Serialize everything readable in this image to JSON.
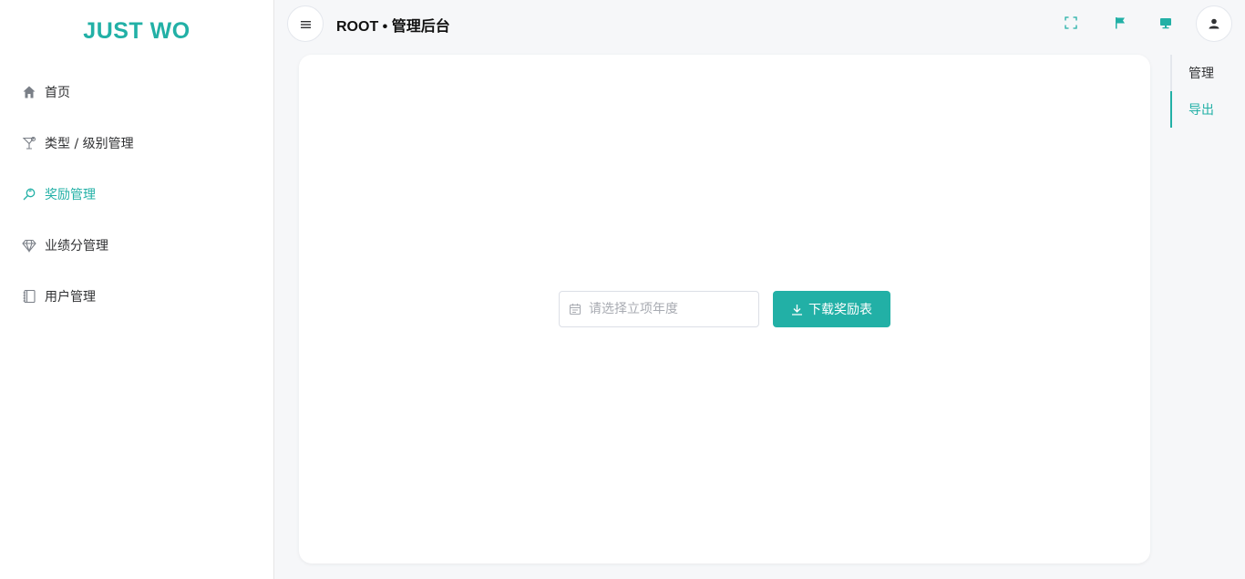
{
  "brand": {
    "logo_text": "JUST WO",
    "accent_color": "#22b0a6"
  },
  "sidebar": {
    "items": [
      {
        "label": "首页",
        "icon": "home-icon",
        "active": false
      },
      {
        "label": "类型 / 级别管理",
        "icon": "cocktail-icon",
        "active": false
      },
      {
        "label": "奖励管理",
        "icon": "search-key-icon",
        "active": true
      },
      {
        "label": "业绩分管理",
        "icon": "diamond-icon",
        "active": false
      },
      {
        "label": "用户管理",
        "icon": "notebook-icon",
        "active": false
      }
    ]
  },
  "header": {
    "toggle_icon": "menu-icon",
    "title": "ROOT • 管理后台",
    "icons": [
      "fullscreen-icon",
      "flag-icon",
      "monitor-icon"
    ],
    "avatar_icon": "user-icon"
  },
  "main": {
    "date_picker": {
      "placeholder": "请选择立项年度",
      "value": ""
    },
    "download_button": {
      "label": "下载奖励表",
      "icon": "download-icon"
    }
  },
  "right_nav": {
    "items": [
      {
        "label": "管理",
        "active": false
      },
      {
        "label": "导出",
        "active": true
      }
    ]
  }
}
